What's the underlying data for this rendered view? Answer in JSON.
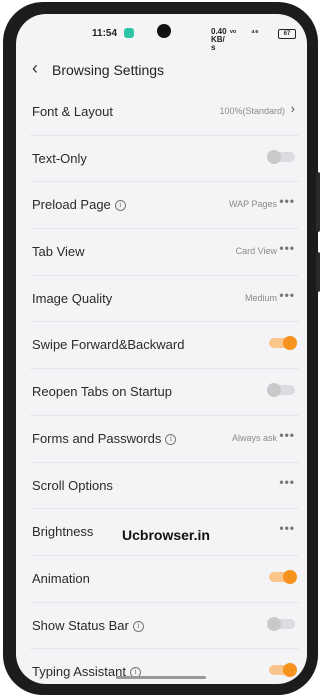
{
  "status_bar": {
    "time": "11:54",
    "net_speed": "0.40 KB/s",
    "signal_1": "ᵛᵒ",
    "signal_2": "⁴⁶",
    "battery": "67"
  },
  "header": {
    "title": "Browsing Settings",
    "back_icon": "chevron-left-icon"
  },
  "settings": [
    {
      "label": "Font & Layout",
      "value": "100%(Standard)",
      "control": "chevron"
    },
    {
      "label": "Text-Only",
      "control": "toggle",
      "on": false
    },
    {
      "label": "Preload Page",
      "info": true,
      "value": "WAP Pages",
      "control": "more"
    },
    {
      "label": "Tab View",
      "value": "Card View",
      "control": "more"
    },
    {
      "label": "Image Quality",
      "value": "Medium",
      "control": "more"
    },
    {
      "label": "Swipe Forward&Backward",
      "control": "toggle",
      "on": true
    },
    {
      "label": "Reopen Tabs on Startup",
      "control": "toggle",
      "on": false
    },
    {
      "label": "Forms and Passwords",
      "info": true,
      "value": "Always ask",
      "control": "more"
    },
    {
      "label": "Scroll Options",
      "control": "more"
    },
    {
      "label": "Brightness",
      "control": "more"
    },
    {
      "label": "Animation",
      "control": "toggle",
      "on": true
    },
    {
      "label": "Show Status Bar",
      "info": true,
      "control": "toggle",
      "on": false
    },
    {
      "label": "Typing Assistant",
      "info": true,
      "control": "toggle",
      "on": true
    }
  ],
  "glyphs": {
    "chevron_right": "›",
    "more": "•••",
    "info": "i",
    "back": "‹"
  },
  "watermark": "Ucbrowser.in",
  "colors": {
    "accent": "#f5931e",
    "toggle_off": "#c9c9cc",
    "background": "#f4f4f6"
  }
}
